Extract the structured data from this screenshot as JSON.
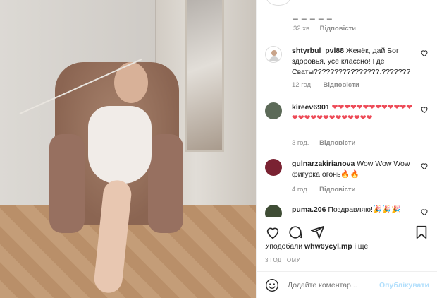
{
  "post": {
    "top_fragment_text": "_ _ _ _ _",
    "top_meta_time": "32 хв",
    "reply_label": "Відповісти",
    "comments": [
      {
        "username": "shtyrbul_pvl88",
        "text": "Женёк, дай Бог здоровья, усё классно! Где Сваты????????????????.???????",
        "time": "12 год.",
        "avatar_color": "#ffffff"
      },
      {
        "username": "kireev6901",
        "text": "❤❤❤❤❤❤❤❤❤❤❤❤❤❤❤❤❤❤❤❤❤❤❤❤❤❤",
        "time": "3 год.",
        "avatar_color": "#5c6a58"
      },
      {
        "username": "gulnarzakirianova",
        "text": "Wow Wow Wow фигурка огонь🔥🔥",
        "time": "4 год.",
        "avatar_color": "#7a2232"
      },
      {
        "username": "puma.206",
        "text": "Поздравляю!🎉🎉🎉",
        "time": "",
        "avatar_color": "#3f4d35"
      }
    ],
    "likes_prefix": "Уподобали",
    "likes_user": "whw6ycyl.mp",
    "likes_suffix": "і ще",
    "timestamp": "3 ГОД ТОМУ",
    "comment_placeholder": "Додайте коментар...",
    "post_button": "Опублікувати",
    "icons": {
      "like": "heart-icon",
      "comment": "comment-icon",
      "share": "share-icon",
      "save": "bookmark-icon",
      "emoji": "emoji-icon"
    },
    "accent_color": "#0095f6",
    "heart_color": "#ed4956"
  }
}
